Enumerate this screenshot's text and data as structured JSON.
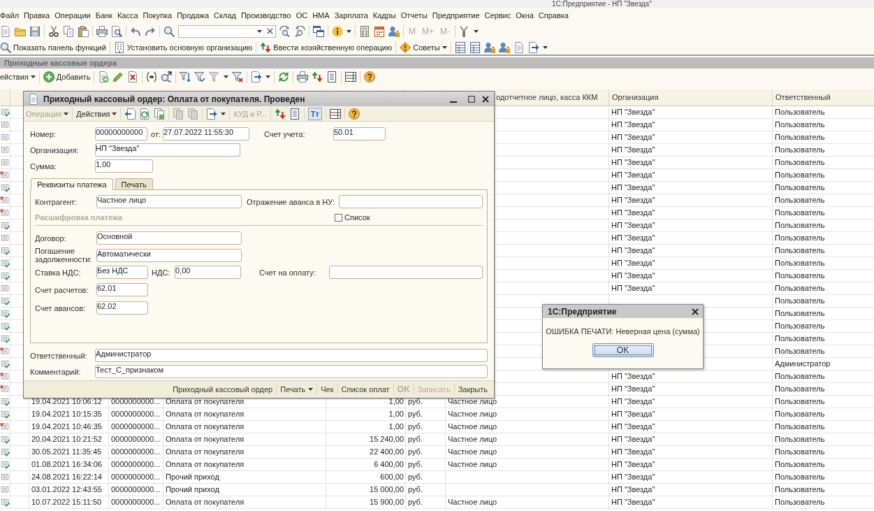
{
  "window": {
    "title": "1С:Предприятие - НП \"Звезда\""
  },
  "menu": [
    "Файл",
    "Правка",
    "Операции",
    "Банк",
    "Касса",
    "Покупка",
    "Продажа",
    "Склад",
    "Производство",
    "ОС",
    "НМА",
    "Зарплата",
    "Кадры",
    "Отчеты",
    "Предприятие",
    "Сервис",
    "Окна",
    "Справка"
  ],
  "toolbar": {
    "memory_buttons": [
      {
        "label": "M",
        "disabled": true
      },
      {
        "label": "M+",
        "disabled": true
      },
      {
        "label": "M-",
        "disabled": true
      }
    ]
  },
  "function_bar": [
    {
      "label": "Показать панель функций"
    },
    {
      "label": "Установить основную организацию"
    },
    {
      "label": "Ввести хозяйственную операцию"
    },
    {
      "label": "Советы"
    }
  ],
  "list_window": {
    "title": "Приходные кассовые ордера",
    "toolbar": {
      "actions_menu": "ействия",
      "add_button": "Добавить"
    },
    "table": {
      "columns": {
        "contragent": "одотчетное лицо, касса ККМ",
        "organization": "Организация",
        "responsible": "Ответственный"
      },
      "rows": [
        {
          "posted": true,
          "deletion_mark": false,
          "organization": "НП \"Звезда\"",
          "responsible": "Пользователь"
        },
        {
          "posted": false,
          "deletion_mark": false,
          "organization": "НП \"Звезда\"",
          "responsible": "Пользователь"
        },
        {
          "posted": false,
          "deletion_mark": false,
          "organization": "НП \"Звезда\"",
          "responsible": "Пользователь"
        },
        {
          "posted": false,
          "deletion_mark": false,
          "organization": "НП \"Звезда\"",
          "responsible": "Пользователь"
        },
        {
          "posted": false,
          "deletion_mark": false,
          "organization": "НП \"Звезда\"",
          "responsible": "Пользователь"
        },
        {
          "posted": false,
          "deletion_mark": true,
          "organization": "НП \"Звезда\"",
          "responsible": "Пользователь"
        },
        {
          "posted": true,
          "deletion_mark": false,
          "organization": "НП \"Звезда\"",
          "responsible": "Пользователь"
        },
        {
          "posted": false,
          "deletion_mark": true,
          "organization": "НП \"Звезда\"",
          "responsible": "Пользователь"
        },
        {
          "posted": false,
          "deletion_mark": true,
          "organization": "НП \"Звезда\"",
          "responsible": "Пользователь"
        },
        {
          "posted": true,
          "deletion_mark": false,
          "organization": "НП \"Звезда\"",
          "responsible": "Пользователь"
        },
        {
          "posted": false,
          "deletion_mark": false,
          "organization": "НП \"Звезда\"",
          "responsible": "Пользователь"
        },
        {
          "posted": true,
          "deletion_mark": false,
          "organization": "НП \"Звезда\"",
          "responsible": "Пользователь"
        },
        {
          "posted": true,
          "deletion_mark": false,
          "organization": "НП \"Звезда\"",
          "responsible": "Пользователь"
        },
        {
          "posted": true,
          "deletion_mark": false,
          "organization": "НП \"Звезда\"",
          "responsible": "Пользователь"
        },
        {
          "posted": false,
          "deletion_mark": false,
          "organization": "НП \"Звезда\"",
          "responsible": "Пользователь"
        },
        {
          "posted": true,
          "deletion_mark": false,
          "responsible": "Пользователь"
        },
        {
          "posted": true,
          "deletion_mark": false,
          "responsible": "Пользователь"
        },
        {
          "posted": true,
          "deletion_mark": false,
          "responsible": "Пользователь"
        },
        {
          "posted": true,
          "deletion_mark": false,
          "responsible": "Пользователь"
        },
        {
          "posted": false,
          "deletion_mark": true,
          "responsible": "Пользователь"
        },
        {
          "posted": true,
          "deletion_mark": false,
          "responsible": "Администратор"
        },
        {
          "posted": false,
          "deletion_mark": true,
          "organization": "НП \"Звезда\"",
          "responsible": "Пользователь"
        },
        {
          "posted": false,
          "deletion_mark": true,
          "organization": "НП \"Звезда\"",
          "responsible": "Пользователь"
        },
        {
          "posted": true,
          "deletion_mark": false,
          "date": "19.04.2021 10:06:12",
          "number": "0000000000...",
          "operation": "Оплата от покупателя",
          "amount": "1,00",
          "currency": "руб.",
          "contragent": "Частное лицо",
          "organization": "НП \"Звезда\"",
          "responsible": "Пользователь"
        },
        {
          "posted": true,
          "deletion_mark": false,
          "date": "19.04.2021 10:15:35",
          "number": "0000000000...",
          "operation": "Оплата от покупателя",
          "amount": "1,00",
          "currency": "руб.",
          "contragent": "Частное лицо",
          "organization": "НП \"Звезда\"",
          "responsible": "Пользователь"
        },
        {
          "posted": false,
          "deletion_mark": true,
          "date": "19.04.2021 10:46:35",
          "number": "0000000000...",
          "operation": "Оплата от покупателя",
          "amount": "1,00",
          "currency": "руб.",
          "contragent": "Частное лицо",
          "organization": "НП \"Звезда\"",
          "responsible": "Пользователь"
        },
        {
          "posted": true,
          "deletion_mark": false,
          "date": "20.04.2021 10:21:52",
          "number": "0000000000...",
          "operation": "Оплата от покупателя",
          "amount": "15 240,00",
          "currency": "руб.",
          "contragent": "Частное лицо",
          "organization": "НП \"Звезда\"",
          "responsible": "Пользователь"
        },
        {
          "posted": true,
          "deletion_mark": false,
          "date": "30.05.2021 11:35:45",
          "number": "0000000000...",
          "operation": "Оплата от покупателя",
          "amount": "22 400,00",
          "currency": "руб.",
          "contragent": "Частное лицо",
          "organization": "НП \"Звезда\"",
          "responsible": "Пользователь"
        },
        {
          "posted": true,
          "deletion_mark": false,
          "date": "01.08.2021 16:34:06",
          "number": "0000000000...",
          "operation": "Оплата от покупателя",
          "amount": "6 400,00",
          "currency": "руб.",
          "contragent": "Частное лицо",
          "organization": "НП \"Звезда\"",
          "responsible": "Пользователь"
        },
        {
          "posted": false,
          "deletion_mark": false,
          "date": "24.08.2021 16:22:14",
          "number": "0000000000...",
          "operation": "Прочий приход",
          "amount": "600,00",
          "currency": "руб.",
          "organization": "НП \"Звезда\"",
          "responsible": "Пользователь"
        },
        {
          "posted": false,
          "deletion_mark": false,
          "date": "03.01.2022 12:43:55",
          "number": "0000000000...",
          "operation": "Прочий приход",
          "amount": "15 000,00",
          "currency": "руб.",
          "organization": "НП \"Звезда\"",
          "responsible": "Пользователь"
        },
        {
          "posted": true,
          "deletion_mark": false,
          "date": "10.07.2022 15:11:50",
          "number": "0000000000...",
          "operation": "Оплата от покупателя",
          "amount": "15 900,00",
          "currency": "руб.",
          "contragent": "Частное лицо",
          "organization": "НП \"Звезда\"",
          "responsible": "Пользователь"
        }
      ]
    }
  },
  "document_form": {
    "title": "Приходный кассовый ордер: Оплата от покупателя. Проведен",
    "toolbar": {
      "operation_menu": {
        "label": "Операция",
        "disabled": true
      },
      "actions_menu": {
        "label": "Действия",
        "disabled": false
      },
      "kud_button": {
        "label": "КУД и Р...",
        "disabled": true
      },
      "text_toggle": {
        "label": "Тт",
        "pressed": true
      }
    },
    "number": {
      "label": "Номер:",
      "value": "00000000000"
    },
    "date": {
      "label": "от:",
      "value": "27.07.2022 11:55:30"
    },
    "account": {
      "label": "Счет учета:",
      "value": "50.01"
    },
    "organization": {
      "label": "Организация:",
      "value": "НП \"Звезда\""
    },
    "amount": {
      "label": "Сумма:",
      "value": "1,00"
    },
    "tabs": [
      {
        "label": "Реквизиты платежа",
        "selected": true
      },
      {
        "label": "Печать",
        "selected": false
      }
    ],
    "payment": {
      "contragent": {
        "label": "Контрагент:",
        "value": "Частное лицо"
      },
      "advance_reflection": {
        "label": "Отражение аванса в НУ:"
      },
      "section_title": "Расшифровка платежа",
      "list_checkbox": {
        "label": "Список",
        "checked": false
      },
      "contract": {
        "label": "Договор:",
        "value": "Основной"
      },
      "repayment": {
        "label": "Погашение задолженности:",
        "value": "Автоматически"
      },
      "vat_rate": {
        "label": "Ставка НДС:",
        "value": "Без НДС"
      },
      "vat": {
        "label": "НДС:",
        "value": "0,00"
      },
      "invoice": {
        "label": "Счет на оплату:"
      },
      "settlement_account": {
        "label": "Счет расчетов:",
        "value": "62.01"
      },
      "advance_account": {
        "label": "Счет авансов:",
        "value": "62.02"
      }
    },
    "responsible": {
      "label": "Ответственный:",
      "value": "Администратор"
    },
    "comment": {
      "label": "Комментарий:",
      "value": "Тест_С_признаком"
    },
    "footer_buttons": [
      {
        "label": "Приходный кассовый ордер",
        "disabled": false,
        "default": false,
        "dropdown": false
      },
      {
        "label": "Печать",
        "disabled": false,
        "default": false,
        "dropdown": true
      },
      {
        "label": "Чек",
        "disabled": false,
        "default": false,
        "dropdown": false
      },
      {
        "label": "Список оплат",
        "disabled": false,
        "default": false,
        "dropdown": false
      },
      {
        "label": "OK",
        "disabled": true,
        "default": true,
        "dropdown": false
      },
      {
        "label": "Записать",
        "disabled": true,
        "default": false,
        "dropdown": false
      },
      {
        "label": "Закрыть",
        "disabled": false,
        "default": false,
        "dropdown": false
      }
    ]
  },
  "alert": {
    "title": "1С:Предприятие",
    "message": "ОШИБКА ПЕЧАТИ: Неверная цена (сумма)",
    "button": "OK"
  }
}
